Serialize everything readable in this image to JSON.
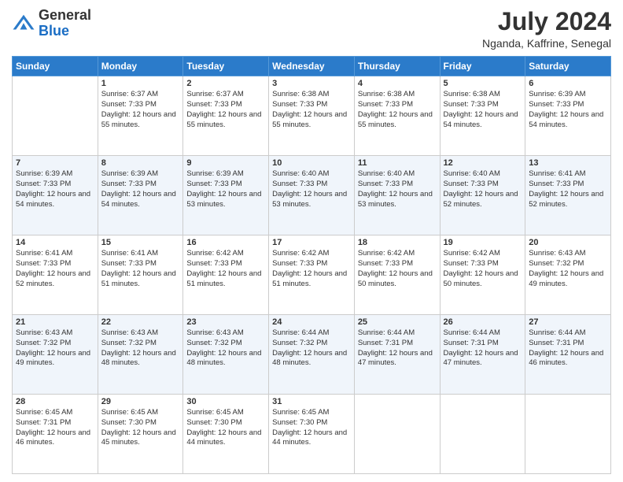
{
  "logo": {
    "line1": "General",
    "line2": "Blue"
  },
  "header": {
    "month_year": "July 2024",
    "location": "Nganda, Kaffrine, Senegal"
  },
  "days_of_week": [
    "Sunday",
    "Monday",
    "Tuesday",
    "Wednesday",
    "Thursday",
    "Friday",
    "Saturday"
  ],
  "weeks": [
    [
      {
        "day": "",
        "sunrise": "",
        "sunset": "",
        "daylight": ""
      },
      {
        "day": "1",
        "sunrise": "Sunrise: 6:37 AM",
        "sunset": "Sunset: 7:33 PM",
        "daylight": "Daylight: 12 hours and 55 minutes."
      },
      {
        "day": "2",
        "sunrise": "Sunrise: 6:37 AM",
        "sunset": "Sunset: 7:33 PM",
        "daylight": "Daylight: 12 hours and 55 minutes."
      },
      {
        "day": "3",
        "sunrise": "Sunrise: 6:38 AM",
        "sunset": "Sunset: 7:33 PM",
        "daylight": "Daylight: 12 hours and 55 minutes."
      },
      {
        "day": "4",
        "sunrise": "Sunrise: 6:38 AM",
        "sunset": "Sunset: 7:33 PM",
        "daylight": "Daylight: 12 hours and 55 minutes."
      },
      {
        "day": "5",
        "sunrise": "Sunrise: 6:38 AM",
        "sunset": "Sunset: 7:33 PM",
        "daylight": "Daylight: 12 hours and 54 minutes."
      },
      {
        "day": "6",
        "sunrise": "Sunrise: 6:39 AM",
        "sunset": "Sunset: 7:33 PM",
        "daylight": "Daylight: 12 hours and 54 minutes."
      }
    ],
    [
      {
        "day": "7",
        "sunrise": "Sunrise: 6:39 AM",
        "sunset": "Sunset: 7:33 PM",
        "daylight": "Daylight: 12 hours and 54 minutes."
      },
      {
        "day": "8",
        "sunrise": "Sunrise: 6:39 AM",
        "sunset": "Sunset: 7:33 PM",
        "daylight": "Daylight: 12 hours and 54 minutes."
      },
      {
        "day": "9",
        "sunrise": "Sunrise: 6:39 AM",
        "sunset": "Sunset: 7:33 PM",
        "daylight": "Daylight: 12 hours and 53 minutes."
      },
      {
        "day": "10",
        "sunrise": "Sunrise: 6:40 AM",
        "sunset": "Sunset: 7:33 PM",
        "daylight": "Daylight: 12 hours and 53 minutes."
      },
      {
        "day": "11",
        "sunrise": "Sunrise: 6:40 AM",
        "sunset": "Sunset: 7:33 PM",
        "daylight": "Daylight: 12 hours and 53 minutes."
      },
      {
        "day": "12",
        "sunrise": "Sunrise: 6:40 AM",
        "sunset": "Sunset: 7:33 PM",
        "daylight": "Daylight: 12 hours and 52 minutes."
      },
      {
        "day": "13",
        "sunrise": "Sunrise: 6:41 AM",
        "sunset": "Sunset: 7:33 PM",
        "daylight": "Daylight: 12 hours and 52 minutes."
      }
    ],
    [
      {
        "day": "14",
        "sunrise": "Sunrise: 6:41 AM",
        "sunset": "Sunset: 7:33 PM",
        "daylight": "Daylight: 12 hours and 52 minutes."
      },
      {
        "day": "15",
        "sunrise": "Sunrise: 6:41 AM",
        "sunset": "Sunset: 7:33 PM",
        "daylight": "Daylight: 12 hours and 51 minutes."
      },
      {
        "day": "16",
        "sunrise": "Sunrise: 6:42 AM",
        "sunset": "Sunset: 7:33 PM",
        "daylight": "Daylight: 12 hours and 51 minutes."
      },
      {
        "day": "17",
        "sunrise": "Sunrise: 6:42 AM",
        "sunset": "Sunset: 7:33 PM",
        "daylight": "Daylight: 12 hours and 51 minutes."
      },
      {
        "day": "18",
        "sunrise": "Sunrise: 6:42 AM",
        "sunset": "Sunset: 7:33 PM",
        "daylight": "Daylight: 12 hours and 50 minutes."
      },
      {
        "day": "19",
        "sunrise": "Sunrise: 6:42 AM",
        "sunset": "Sunset: 7:33 PM",
        "daylight": "Daylight: 12 hours and 50 minutes."
      },
      {
        "day": "20",
        "sunrise": "Sunrise: 6:43 AM",
        "sunset": "Sunset: 7:32 PM",
        "daylight": "Daylight: 12 hours and 49 minutes."
      }
    ],
    [
      {
        "day": "21",
        "sunrise": "Sunrise: 6:43 AM",
        "sunset": "Sunset: 7:32 PM",
        "daylight": "Daylight: 12 hours and 49 minutes."
      },
      {
        "day": "22",
        "sunrise": "Sunrise: 6:43 AM",
        "sunset": "Sunset: 7:32 PM",
        "daylight": "Daylight: 12 hours and 48 minutes."
      },
      {
        "day": "23",
        "sunrise": "Sunrise: 6:43 AM",
        "sunset": "Sunset: 7:32 PM",
        "daylight": "Daylight: 12 hours and 48 minutes."
      },
      {
        "day": "24",
        "sunrise": "Sunrise: 6:44 AM",
        "sunset": "Sunset: 7:32 PM",
        "daylight": "Daylight: 12 hours and 48 minutes."
      },
      {
        "day": "25",
        "sunrise": "Sunrise: 6:44 AM",
        "sunset": "Sunset: 7:31 PM",
        "daylight": "Daylight: 12 hours and 47 minutes."
      },
      {
        "day": "26",
        "sunrise": "Sunrise: 6:44 AM",
        "sunset": "Sunset: 7:31 PM",
        "daylight": "Daylight: 12 hours and 47 minutes."
      },
      {
        "day": "27",
        "sunrise": "Sunrise: 6:44 AM",
        "sunset": "Sunset: 7:31 PM",
        "daylight": "Daylight: 12 hours and 46 minutes."
      }
    ],
    [
      {
        "day": "28",
        "sunrise": "Sunrise: 6:45 AM",
        "sunset": "Sunset: 7:31 PM",
        "daylight": "Daylight: 12 hours and 46 minutes."
      },
      {
        "day": "29",
        "sunrise": "Sunrise: 6:45 AM",
        "sunset": "Sunset: 7:30 PM",
        "daylight": "Daylight: 12 hours and 45 minutes."
      },
      {
        "day": "30",
        "sunrise": "Sunrise: 6:45 AM",
        "sunset": "Sunset: 7:30 PM",
        "daylight": "Daylight: 12 hours and 44 minutes."
      },
      {
        "day": "31",
        "sunrise": "Sunrise: 6:45 AM",
        "sunset": "Sunset: 7:30 PM",
        "daylight": "Daylight: 12 hours and 44 minutes."
      },
      {
        "day": "",
        "sunrise": "",
        "sunset": "",
        "daylight": ""
      },
      {
        "day": "",
        "sunrise": "",
        "sunset": "",
        "daylight": ""
      },
      {
        "day": "",
        "sunrise": "",
        "sunset": "",
        "daylight": ""
      }
    ]
  ]
}
